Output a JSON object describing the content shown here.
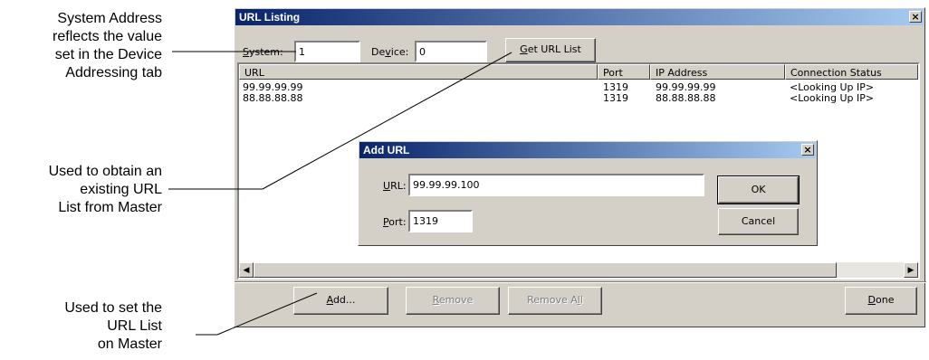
{
  "callouts": {
    "system_address": [
      "System Address",
      "reflects the value",
      "set in the Device",
      "Addressing tab"
    ],
    "get_url_list": [
      "Used to obtain an",
      "existing URL",
      "List from Master"
    ],
    "add": [
      "Used to set the",
      "URL List",
      "on Master"
    ]
  },
  "window": {
    "title": "URL Listing",
    "close_glyph": "×",
    "system_label_prefix": "S",
    "system_label_rest": "ystem:",
    "system_value": "1",
    "device_label_start": "De",
    "device_label_accel": "v",
    "device_label_rest": "ice:",
    "device_value": "0",
    "get_url_list_accel": "G",
    "get_url_list_rest": "et URL List",
    "columns": [
      "URL",
      "Port",
      "IP Address",
      "Connection Status"
    ],
    "rows": [
      {
        "url": "99.99.99.99",
        "port": "1319",
        "ip": "99.99.99.99",
        "status": "<Looking Up IP>"
      },
      {
        "url": "88.88.88.88",
        "port": "1319",
        "ip": "88.88.88.88",
        "status": "<Looking Up IP>"
      }
    ],
    "add_accel": "A",
    "add_rest": "dd...",
    "remove_accel": "R",
    "remove_rest": "emove",
    "remove_all_start": "Remove A",
    "remove_all_accel": "l",
    "remove_all_rest": "l",
    "done_accel": "D",
    "done_rest": "one"
  },
  "dialog": {
    "title": "Add URL",
    "close_glyph": "×",
    "url_label_accel": "U",
    "url_label_rest": "RL:",
    "url_value": "99.99.99.100",
    "port_label_accel": "P",
    "port_label_rest": "ort:",
    "port_value": "1319",
    "ok_label": "OK",
    "cancel_label": "Cancel"
  }
}
